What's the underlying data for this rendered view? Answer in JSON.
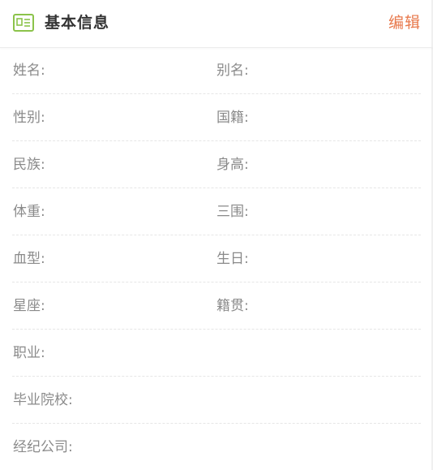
{
  "header": {
    "title": "基本信息",
    "edit_label": "编辑",
    "icon": "id-card-icon",
    "accent_color": "#8bc34a",
    "edit_color": "#e8794c"
  },
  "rows": [
    {
      "left": {
        "label": "姓名:",
        "value": ""
      },
      "right": {
        "label": "别名:",
        "value": ""
      }
    },
    {
      "left": {
        "label": "性别:",
        "value": ""
      },
      "right": {
        "label": "国籍:",
        "value": ""
      }
    },
    {
      "left": {
        "label": "民族:",
        "value": ""
      },
      "right": {
        "label": "身高:",
        "value": ""
      }
    },
    {
      "left": {
        "label": "体重:",
        "value": ""
      },
      "right": {
        "label": "三围:",
        "value": ""
      }
    },
    {
      "left": {
        "label": "血型:",
        "value": ""
      },
      "right": {
        "label": "生日:",
        "value": ""
      }
    },
    {
      "left": {
        "label": "星座:",
        "value": ""
      },
      "right": {
        "label": "籍贯:",
        "value": ""
      }
    },
    {
      "left": {
        "label": "职业:",
        "value": ""
      }
    },
    {
      "left": {
        "label": "毕业院校:",
        "value": ""
      }
    },
    {
      "left": {
        "label": "经纪公司:",
        "value": ""
      }
    }
  ]
}
